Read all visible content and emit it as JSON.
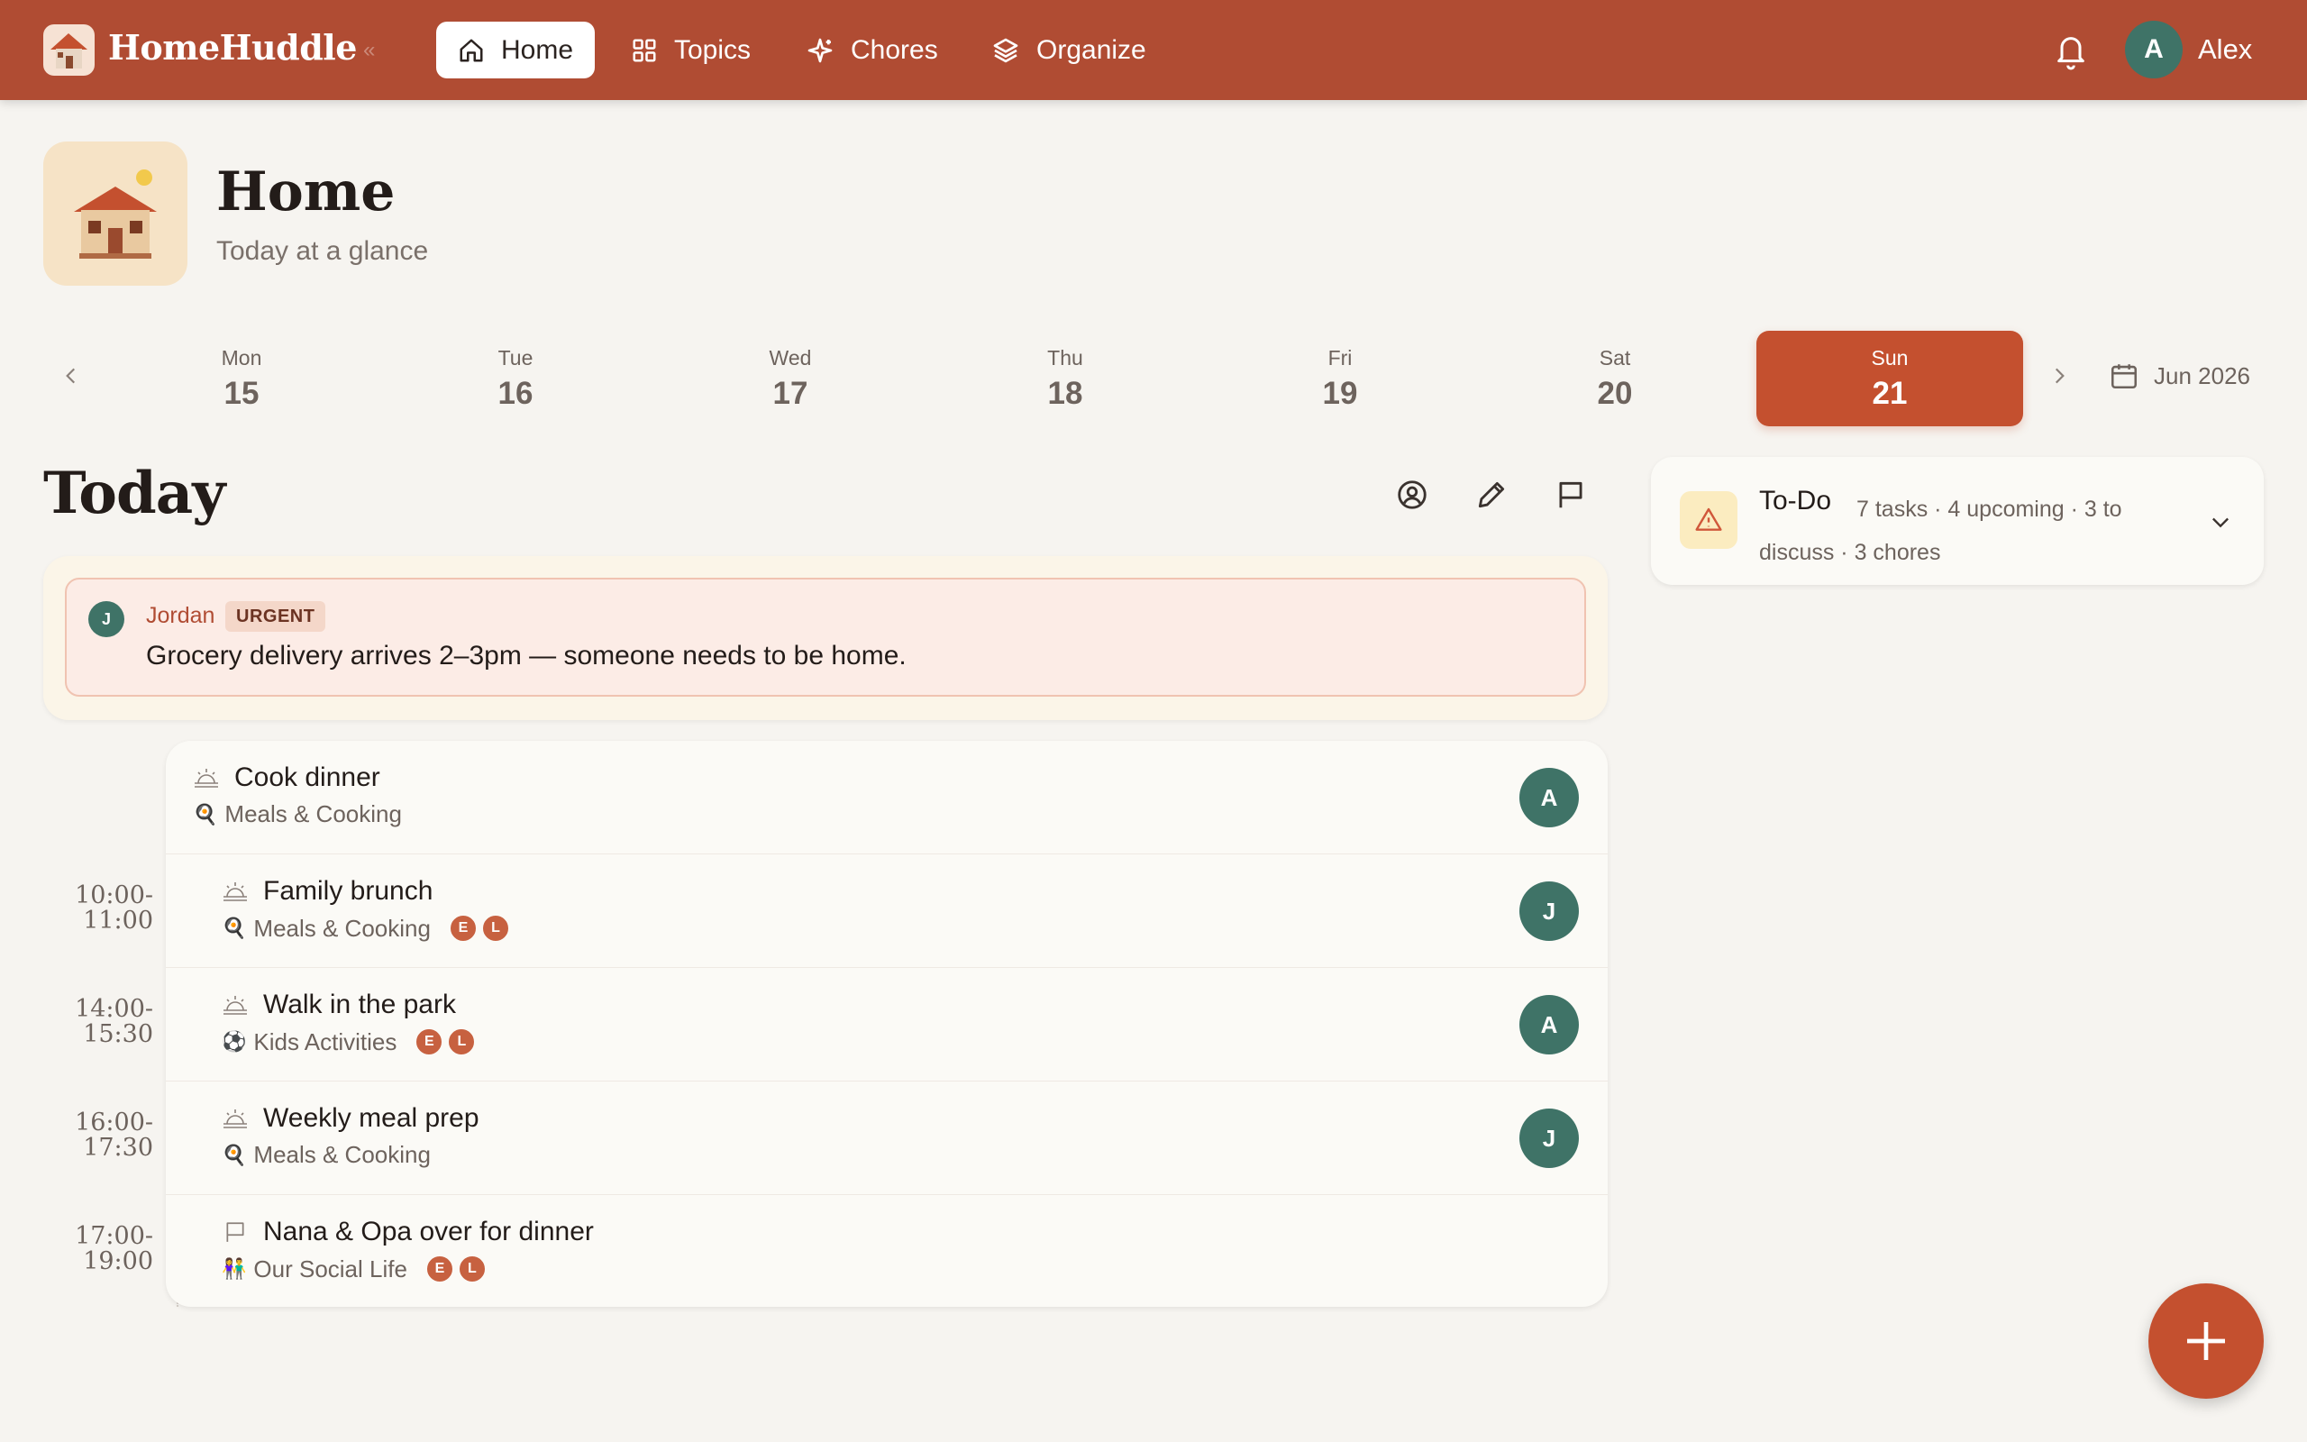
{
  "app": {
    "name": "HomeHuddle",
    "brand_color": "#b04c33",
    "accent_color": "#c4502f",
    "logo_icon": "house-icon"
  },
  "nav": {
    "items": [
      {
        "label": "Home",
        "icon": "home-icon",
        "active": true
      },
      {
        "label": "Topics",
        "icon": "grid-icon",
        "active": false
      },
      {
        "label": "Chores",
        "icon": "sparkle-icon",
        "active": false
      },
      {
        "label": "Organize",
        "icon": "layers-icon",
        "active": false
      }
    ]
  },
  "user": {
    "initial": "A",
    "name": "Alex"
  },
  "header": {
    "title": "Home",
    "subtitle": "Today at a glance"
  },
  "dates": {
    "days": [
      {
        "name": "Mon",
        "num": "15"
      },
      {
        "name": "Tue",
        "num": "16"
      },
      {
        "name": "Wed",
        "num": "17"
      },
      {
        "name": "Thu",
        "num": "18"
      },
      {
        "name": "Fri",
        "num": "19"
      },
      {
        "name": "Sat",
        "num": "20"
      },
      {
        "name": "Sun",
        "num": "21",
        "selected": true
      }
    ],
    "month": "Jun 2026"
  },
  "today": {
    "title": "Today",
    "urgent": {
      "author_initial": "J",
      "author": "Jordan",
      "badge": "URGENT",
      "text": "Grocery delivery arrives 2–3pm — someone needs to be home."
    },
    "events": [
      {
        "time": "",
        "title": "Cook dinner",
        "category": "Meals & Cooking",
        "category_icon": "🍳",
        "type_icon": "sunrise-icon",
        "chips": [],
        "assignee": "A"
      },
      {
        "time_start": "10:00-",
        "time_end": "11:00",
        "title": "Family brunch",
        "category": "Meals & Cooking",
        "category_icon": "🍳",
        "type_icon": "sunrise-icon",
        "chips": [
          "E",
          "L"
        ],
        "assignee": "J"
      },
      {
        "time_start": "14:00-",
        "time_end": "15:30",
        "title": "Walk in the park",
        "category": "Kids Activities",
        "category_icon": "⚽",
        "type_icon": "sunrise-icon",
        "chips": [
          "E",
          "L"
        ],
        "assignee": "A"
      },
      {
        "time_start": "16:00-",
        "time_end": "17:30",
        "title": "Weekly meal prep",
        "category": "Meals & Cooking",
        "category_icon": "🍳",
        "type_icon": "sunrise-icon",
        "chips": [],
        "assignee": "J"
      },
      {
        "time_start": "17:00-",
        "time_end": "19:00",
        "title": "Nana & Opa over for dinner",
        "category": "Our Social Life",
        "category_icon": "👫",
        "type_icon": "flag-icon",
        "chips": [
          "E",
          "L"
        ],
        "assignee": ""
      }
    ]
  },
  "todo": {
    "title": "To-Do",
    "summary": "7 tasks · 4 upcoming · 3 to discuss · 3 chores"
  }
}
